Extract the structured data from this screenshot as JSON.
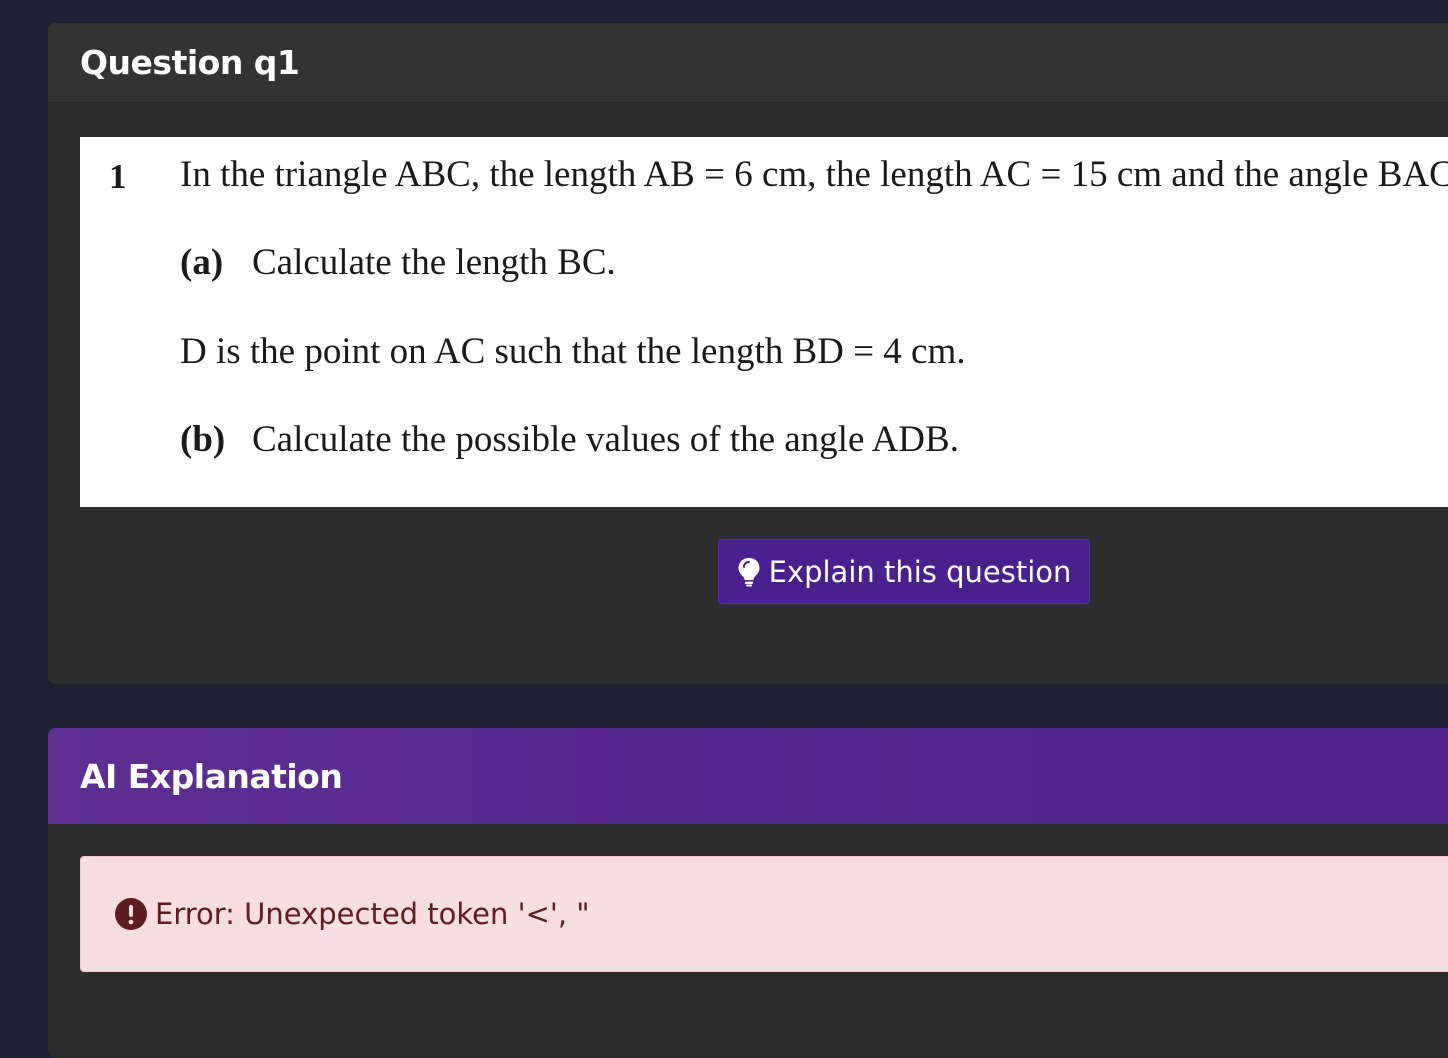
{
  "question_card": {
    "title": "Question q1",
    "number": "1",
    "intro": "In the triangle ABC, the length AB = 6 cm, the length AC = 15 cm and the angle BAC",
    "part_a_label": "(a)",
    "part_a_text": "Calculate the length BC.",
    "point_d_text": "D is the point on AC such that the length BD = 4 cm.",
    "part_b_label": "(b)",
    "part_b_text": "Calculate the possible values of the angle ADB.",
    "explain_button": {
      "label": "Explain this question",
      "icon": "lightbulb-icon"
    }
  },
  "ai_card": {
    "title": "AI Explanation",
    "error": {
      "icon": "exclamation-circle-icon",
      "message": "Error: Unexpected token '<', \""
    }
  },
  "colors": {
    "page_background": "#1d2233",
    "card_background": "#2d2d2d",
    "button_purple": "#4a1f8e",
    "header_purple": "#5d2f93",
    "error_background": "#f8dedf",
    "error_text": "#5f1d22"
  }
}
